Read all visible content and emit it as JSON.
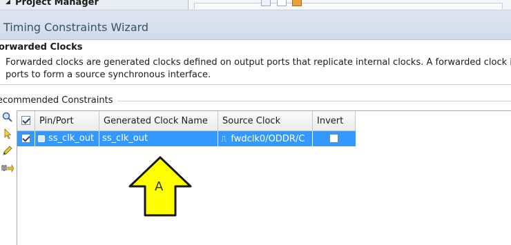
{
  "background_app": {
    "panel_title": "Project Manager"
  },
  "wizard": {
    "title": "Timing Constraints Wizard"
  },
  "page": {
    "heading": "orwarded Clocks",
    "description_line1": "Forwarded clocks are generated clocks defined on output ports that replicate internal clocks. A forwarded clock is",
    "description_line2": "ports to form a source synchronous interface."
  },
  "section": {
    "label": "ecommended Constraints"
  },
  "toolbar": {
    "icons": [
      "search-icon",
      "select-arrow-icon",
      "edit-pencil-icon",
      "clock-forward-icon"
    ]
  },
  "table": {
    "headers": [
      "Pin/Port",
      "Generated Clock Name",
      "Source Clock",
      "Invert"
    ],
    "rows": [
      {
        "selected": true,
        "pin_port": "ss_clk_out",
        "generated_clock_name": "ss_clk_out",
        "source_clock": "fwdclk0/ODDR/C",
        "invert": false
      }
    ]
  },
  "annotation": {
    "label": "A",
    "color": "#ffff00"
  }
}
